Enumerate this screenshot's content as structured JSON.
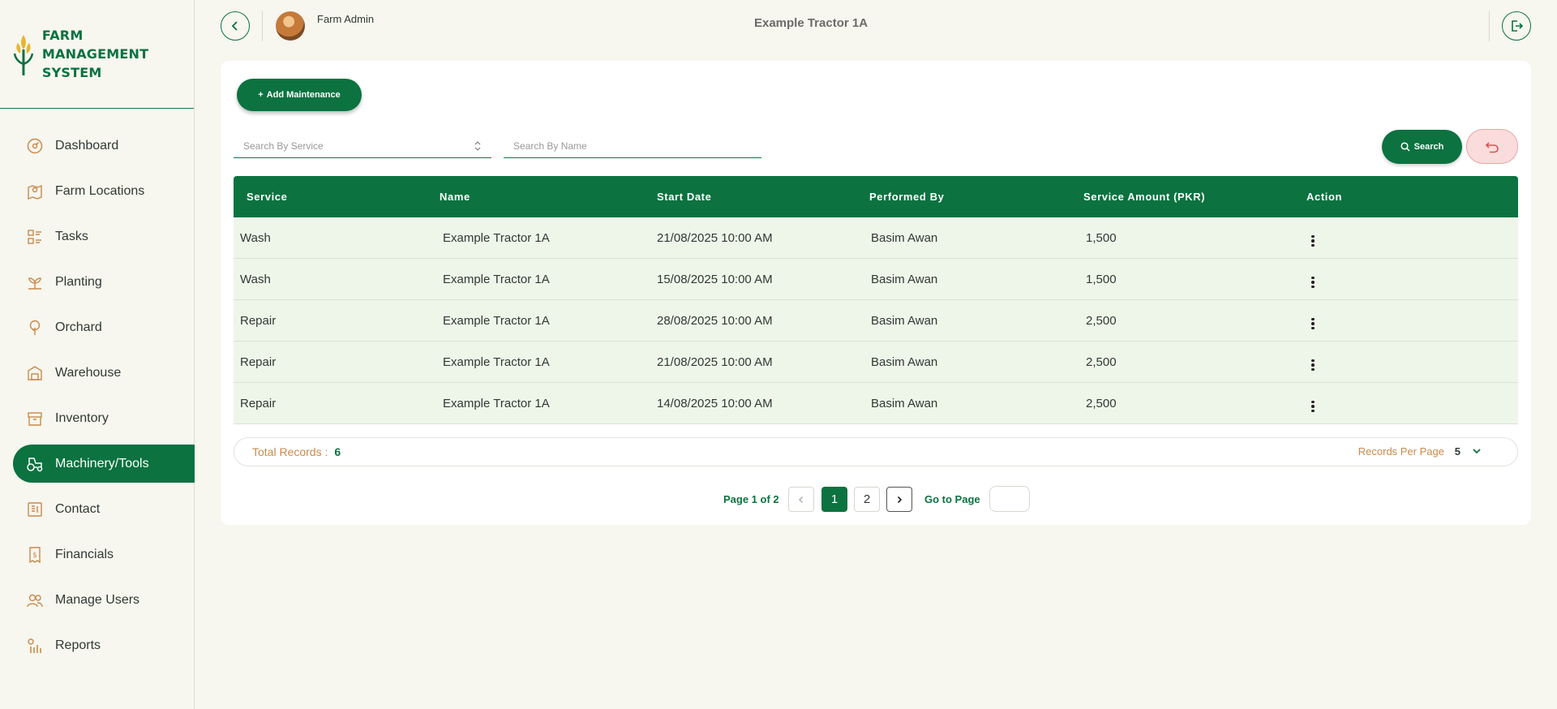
{
  "brand": {
    "line1": "FARM MANAGEMENT",
    "line2": "SYSTEM"
  },
  "sidebar": {
    "items": [
      {
        "label": "Dashboard",
        "icon": "dashboard-icon"
      },
      {
        "label": "Farm Locations",
        "icon": "map-pin-icon"
      },
      {
        "label": "Tasks",
        "icon": "tasks-list-icon"
      },
      {
        "label": "Planting",
        "icon": "sprout-icon"
      },
      {
        "label": "Orchard",
        "icon": "tree-icon"
      },
      {
        "label": "Warehouse",
        "icon": "warehouse-icon"
      },
      {
        "label": "Inventory",
        "icon": "archive-box-icon"
      },
      {
        "label": "Machinery/Tools",
        "icon": "tractor-icon",
        "active": true
      },
      {
        "label": "Contact",
        "icon": "contact-book-icon"
      },
      {
        "label": "Financials",
        "icon": "invoice-dollar-icon"
      },
      {
        "label": "Manage Users",
        "icon": "users-icon"
      },
      {
        "label": "Reports",
        "icon": "reports-icon"
      }
    ]
  },
  "header": {
    "username": "Farm Admin",
    "title": "Example Tractor 1A"
  },
  "toolbar": {
    "add_label": "Add Maintenance",
    "search_label": "Search"
  },
  "filters": {
    "service_placeholder": "Search By Service",
    "name_placeholder": "Search By Name"
  },
  "table": {
    "columns": [
      "Service",
      "Name",
      "Start Date",
      "Performed By",
      "Service Amount (PKR)",
      "Action"
    ],
    "rows": [
      [
        "Wash",
        "Example Tractor 1A",
        "21/08/2025 10:00 AM",
        "Basim Awan",
        "1,500"
      ],
      [
        "Wash",
        "Example Tractor 1A",
        "15/08/2025 10:00 AM",
        "Basim Awan",
        "1,500"
      ],
      [
        "Repair",
        "Example Tractor 1A",
        "28/08/2025 10:00 AM",
        "Basim Awan",
        "2,500"
      ],
      [
        "Repair",
        "Example Tractor 1A",
        "21/08/2025 10:00 AM",
        "Basim Awan",
        "2,500"
      ],
      [
        "Repair",
        "Example Tractor 1A",
        "14/08/2025 10:00 AM",
        "Basim Awan",
        "2,500"
      ]
    ]
  },
  "records": {
    "total_label": "Total Records :",
    "total_value": "6",
    "per_page_label": "Records Per Page",
    "per_page_value": "5"
  },
  "pagination": {
    "info": "Page 1 of 2",
    "pages": [
      "1",
      "2"
    ],
    "current": "1",
    "goto_label": "Go to Page"
  },
  "colors": {
    "primary": "#0b7240",
    "accent": "#c98a4a",
    "row_bg": "#eef6ea",
    "reset_bg": "#fbdcdc"
  }
}
